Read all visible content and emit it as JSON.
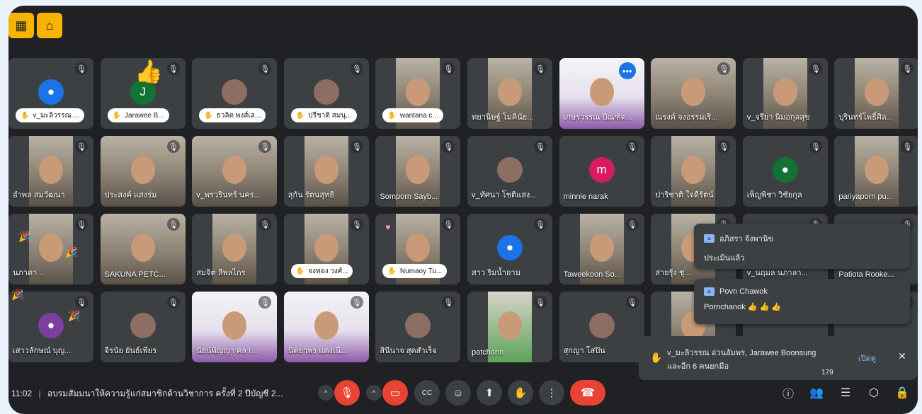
{
  "tiles": [
    {
      "name": "v_มะลิวรรณ ...",
      "kind": "pill",
      "av": "user",
      "bg": "#1a73e8"
    },
    {
      "name": "Jarawee B...",
      "kind": "pill",
      "av": "J",
      "bg": "#137333"
    },
    {
      "name": "ธวลิต พงส์เล...",
      "kind": "pill",
      "av": "photo"
    },
    {
      "name": "ปรีชาติ สมนุ...",
      "kind": "pill",
      "av": "photo"
    },
    {
      "name": "wantana c...",
      "kind": "pill",
      "av": "video"
    },
    {
      "name": "ทยานิษฐ์ โมคินัย...",
      "kind": "label",
      "av": "video"
    },
    {
      "name": "เกษรวรรณ ปัณฑิต...",
      "kind": "label",
      "av": "slide",
      "hl": true
    },
    {
      "name": "ณรงค์ จงอรรมเริ...",
      "kind": "label",
      "av": "wide"
    },
    {
      "name": "v_จรียา นิมอกุลสุข",
      "kind": "label",
      "av": "video"
    },
    {
      "name": "บุรินทร์โพธิ์ศิล...",
      "kind": "label",
      "av": "video"
    },
    {
      "name": "อำพล สมวัฒนา",
      "kind": "label",
      "av": "video"
    },
    {
      "name": "ประสงค์ แสงร่ม",
      "kind": "label",
      "av": "wide"
    },
    {
      "name": "v_พรวรินทร์ นคร...",
      "kind": "label",
      "av": "wide"
    },
    {
      "name": "สุกัน รัตนสุทธิ",
      "kind": "label",
      "av": "video"
    },
    {
      "name": "Somporn Sayb...",
      "kind": "label",
      "av": "video"
    },
    {
      "name": "v_ทัศนา โชติแสง...",
      "kind": "label",
      "av": "photo"
    },
    {
      "name": "minnie narak",
      "kind": "label",
      "av": "m",
      "bg": "#d81b60"
    },
    {
      "name": "ปาริชาติ ใจดีรัตน์",
      "kind": "label",
      "av": "video"
    },
    {
      "name": "เพ็ญพิชา วิชัยกุล",
      "kind": "label",
      "av": "user",
      "bg": "#137333"
    },
    {
      "name": "pariyaporn pu...",
      "kind": "label",
      "av": "video"
    },
    {
      "name": "นภาดา ...",
      "kind": "label",
      "av": "video"
    },
    {
      "name": "SAKUNA PETC...",
      "kind": "label",
      "av": "wide"
    },
    {
      "name": "สมจิต ลีพลไกร",
      "kind": "label",
      "av": "video"
    },
    {
      "name": "จงทอง วงศ์...",
      "kind": "pill",
      "av": "video"
    },
    {
      "name": "Numaoy Tu...",
      "kind": "pill",
      "av": "video",
      "heart": true
    },
    {
      "name": "สาว ริมน้ำยาม",
      "kind": "label",
      "av": "user",
      "bg": "#1a73e8"
    },
    {
      "name": "Taweekoon So...",
      "kind": "label",
      "av": "video"
    },
    {
      "name": "สายรุ้ง ชุ...",
      "kind": "label",
      "av": "video"
    },
    {
      "name": "v_นฤมล นภาลา...",
      "kind": "label",
      "av": "none"
    },
    {
      "name": "Patiota Rooke...",
      "kind": "label",
      "av": "none"
    },
    {
      "name": "เสาวลักษณ์ บุญ...",
      "kind": "label",
      "av": "user",
      "bg": "#7b3fa0"
    },
    {
      "name": "จีรนัย ยันธ์เพียร",
      "kind": "label",
      "av": "photo"
    },
    {
      "name": "นัยน์พิญญา คลา...",
      "kind": "label",
      "av": "slide"
    },
    {
      "name": "นิตยาพร แดงเนื...",
      "kind": "label",
      "av": "slide"
    },
    {
      "name": "สินีนาจ สุดสำเร็จ",
      "kind": "label",
      "av": "photo"
    },
    {
      "name": "patcharin",
      "kind": "label",
      "av": "green"
    },
    {
      "name": "สุกญา โสปิน",
      "kind": "label",
      "av": "photo"
    },
    {
      "name": "",
      "kind": "label",
      "av": "video"
    },
    {
      "name": "",
      "kind": "label",
      "av": "none"
    },
    {
      "name": "",
      "kind": "label",
      "av": "none"
    }
  ],
  "chat_messages": [
    {
      "sender": "อภิสรา จังพานิข",
      "message": "ประเมินแล้ว"
    },
    {
      "sender": "Povn Chawok",
      "message": "Pornchanok 👍 👍 👍"
    }
  ],
  "raised_hands": {
    "text": "v_มะลิวรรณ อ่วนอัมพร, Jarawee Boonsung",
    "text2": "และอีก 6 คนยกมือ",
    "view_label": "เปิดดู",
    "close": "✕"
  },
  "bottom": {
    "time": "11:02",
    "separator": "|",
    "meeting_title": "อบรมสัมมนาให้ความรู้แก่สมาชิกด้านวิชาการ ครั้งที่ 2 ปีบัญชี 2...",
    "participants_count": "179"
  },
  "colors": {
    "accent": "#8ab4f8",
    "end_call": "#ea4335",
    "tile_bg": "#3c4043",
    "bg": "#202124",
    "top_icon": "#f6b400"
  }
}
